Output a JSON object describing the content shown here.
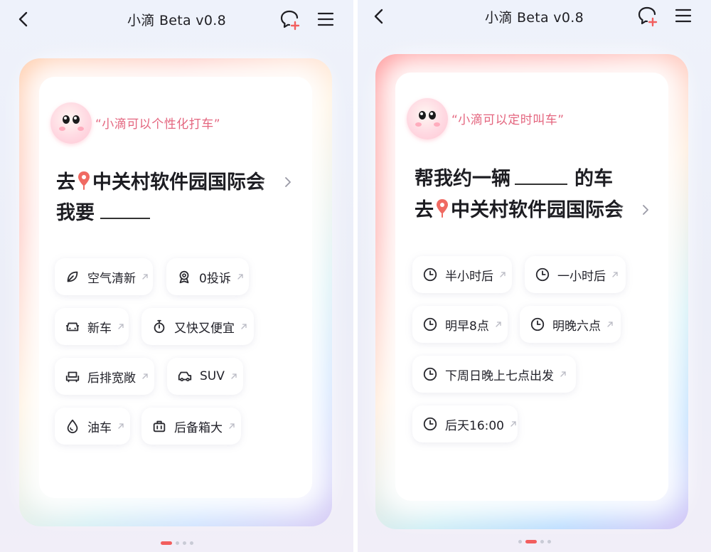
{
  "app_title": "小滴 Beta v0.8",
  "colors": {
    "accent": "#f25e5e",
    "hint_pink": "#e4667f",
    "text": "#1d1d22"
  },
  "icons": {
    "back": "chevron-left-icon",
    "chat": "chat-plus-icon",
    "menu": "hamburger-menu-icon",
    "pin": "location-pin-icon"
  },
  "left": {
    "hint": "“小滴可以个性化打车”",
    "line1_prefix": "去",
    "destination": "中关村软件园国际会",
    "line2_prefix": "我要",
    "chips": [
      {
        "label": "空气清新",
        "icon": "leaf-icon"
      },
      {
        "label": "0投诉",
        "icon": "badge-icon"
      },
      {
        "label": "新车",
        "icon": "car-icon"
      },
      {
        "label": "又快又便宜",
        "icon": "stopwatch-icon"
      },
      {
        "label": "后排宽敞",
        "icon": "seat-icon"
      },
      {
        "label": "SUV",
        "icon": "suv-icon"
      },
      {
        "label": "油车",
        "icon": "fuel-drop-icon"
      },
      {
        "label": "后备箱大",
        "icon": "luggage-icon"
      }
    ]
  },
  "right": {
    "hint": "“小滴可以定时叫车”",
    "line1_prefix": "帮我约一辆",
    "line1_suffix": "的车",
    "line2_prefix": "去",
    "destination": "中关村软件园国际会",
    "chips": [
      {
        "label": "半小时后",
        "icon": "clock-icon"
      },
      {
        "label": "一小时后",
        "icon": "clock-icon"
      },
      {
        "label": "明早8点",
        "icon": "clock-icon"
      },
      {
        "label": "明晚六点",
        "icon": "clock-icon"
      },
      {
        "label": "下周日晚上七点出发",
        "icon": "clock-icon"
      },
      {
        "label": "后天16:00",
        "icon": "clock-icon"
      }
    ]
  }
}
